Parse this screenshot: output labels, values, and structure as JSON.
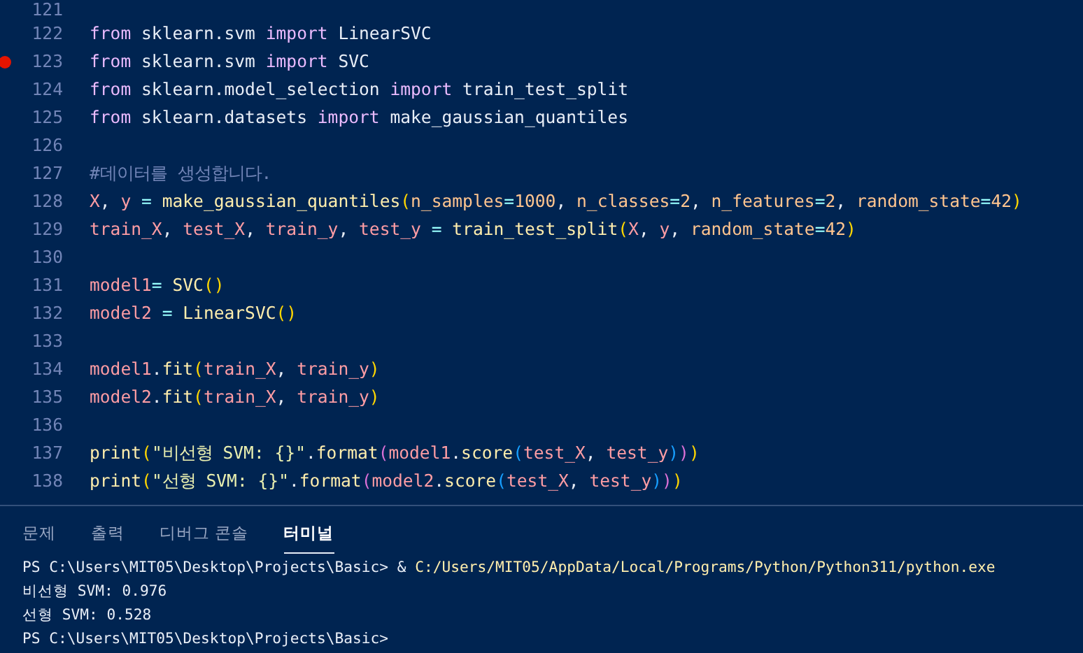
{
  "editor": {
    "lines": [
      {
        "number": "121",
        "breakpoint": false
      },
      {
        "number": "122",
        "breakpoint": false,
        "tokens": [
          {
            "text": "from",
            "kind": "k"
          },
          {
            "text": " sklearn.svm ",
            "kind": "m"
          },
          {
            "text": "import",
            "kind": "k"
          },
          {
            "text": " LinearSVC",
            "kind": "m"
          }
        ]
      },
      {
        "number": "123",
        "breakpoint": true,
        "tokens": [
          {
            "text": "from",
            "kind": "k"
          },
          {
            "text": " sklearn.svm ",
            "kind": "m"
          },
          {
            "text": "import",
            "kind": "k"
          },
          {
            "text": " SVC",
            "kind": "m"
          }
        ]
      },
      {
        "number": "124",
        "breakpoint": false,
        "tokens": [
          {
            "text": "from",
            "kind": "k"
          },
          {
            "text": " sklearn.model_selection ",
            "kind": "m"
          },
          {
            "text": "import",
            "kind": "k"
          },
          {
            "text": " train_test_split",
            "kind": "m"
          }
        ]
      },
      {
        "number": "125",
        "breakpoint": false,
        "tokens": [
          {
            "text": "from",
            "kind": "k"
          },
          {
            "text": " sklearn.datasets ",
            "kind": "m"
          },
          {
            "text": "import",
            "kind": "k"
          },
          {
            "text": " make_gaussian_quantiles",
            "kind": "m"
          }
        ]
      },
      {
        "number": "126",
        "breakpoint": false
      },
      {
        "number": "127",
        "breakpoint": false,
        "tokens": [
          {
            "text": "#데이터를 생성합니다.",
            "kind": "c"
          }
        ]
      },
      {
        "number": "128",
        "breakpoint": false,
        "tokens": [
          {
            "text": "X",
            "kind": "v"
          },
          {
            "text": ", ",
            "kind": "m"
          },
          {
            "text": "y",
            "kind": "v"
          },
          {
            "text": " = ",
            "kind": "o"
          },
          {
            "text": "make_gaussian_quantiles",
            "kind": "f"
          },
          {
            "text": "(",
            "kind": "p1"
          },
          {
            "text": "n_samples",
            "kind": "n"
          },
          {
            "text": "=",
            "kind": "o"
          },
          {
            "text": "1000",
            "kind": "n"
          },
          {
            "text": ", ",
            "kind": "m"
          },
          {
            "text": "n_classes",
            "kind": "n"
          },
          {
            "text": "=",
            "kind": "o"
          },
          {
            "text": "2",
            "kind": "n"
          },
          {
            "text": ", ",
            "kind": "m"
          },
          {
            "text": "n_features",
            "kind": "n"
          },
          {
            "text": "=",
            "kind": "o"
          },
          {
            "text": "2",
            "kind": "n"
          },
          {
            "text": ", ",
            "kind": "m"
          },
          {
            "text": "random_state",
            "kind": "n"
          },
          {
            "text": "=",
            "kind": "o"
          },
          {
            "text": "42",
            "kind": "n"
          },
          {
            "text": ")",
            "kind": "p1"
          }
        ]
      },
      {
        "number": "129",
        "breakpoint": false,
        "tokens": [
          {
            "text": "train_X",
            "kind": "v"
          },
          {
            "text": ", ",
            "kind": "m"
          },
          {
            "text": "test_X",
            "kind": "v"
          },
          {
            "text": ", ",
            "kind": "m"
          },
          {
            "text": "train_y",
            "kind": "v"
          },
          {
            "text": ", ",
            "kind": "m"
          },
          {
            "text": "test_y",
            "kind": "v"
          },
          {
            "text": " = ",
            "kind": "o"
          },
          {
            "text": "train_test_split",
            "kind": "f"
          },
          {
            "text": "(",
            "kind": "p1"
          },
          {
            "text": "X",
            "kind": "v"
          },
          {
            "text": ", ",
            "kind": "m"
          },
          {
            "text": "y",
            "kind": "v"
          },
          {
            "text": ", ",
            "kind": "m"
          },
          {
            "text": "random_state",
            "kind": "n"
          },
          {
            "text": "=",
            "kind": "o"
          },
          {
            "text": "42",
            "kind": "n"
          },
          {
            "text": ")",
            "kind": "p1"
          }
        ]
      },
      {
        "number": "130",
        "breakpoint": false
      },
      {
        "number": "131",
        "breakpoint": false,
        "tokens": [
          {
            "text": "model1",
            "kind": "v"
          },
          {
            "text": "= ",
            "kind": "o"
          },
          {
            "text": "SVC",
            "kind": "f"
          },
          {
            "text": "()",
            "kind": "p1"
          }
        ]
      },
      {
        "number": "132",
        "breakpoint": false,
        "tokens": [
          {
            "text": "model2",
            "kind": "v"
          },
          {
            "text": " = ",
            "kind": "o"
          },
          {
            "text": "LinearSVC",
            "kind": "f"
          },
          {
            "text": "()",
            "kind": "p1"
          }
        ]
      },
      {
        "number": "133",
        "breakpoint": false
      },
      {
        "number": "134",
        "breakpoint": false,
        "tokens": [
          {
            "text": "model1",
            "kind": "v"
          },
          {
            "text": ".",
            "kind": "m"
          },
          {
            "text": "fit",
            "kind": "f"
          },
          {
            "text": "(",
            "kind": "p1"
          },
          {
            "text": "train_X",
            "kind": "v"
          },
          {
            "text": ", ",
            "kind": "m"
          },
          {
            "text": "train_y",
            "kind": "v"
          },
          {
            "text": ")",
            "kind": "p1"
          }
        ]
      },
      {
        "number": "135",
        "breakpoint": false,
        "tokens": [
          {
            "text": "model2",
            "kind": "v"
          },
          {
            "text": ".",
            "kind": "m"
          },
          {
            "text": "fit",
            "kind": "f"
          },
          {
            "text": "(",
            "kind": "p1"
          },
          {
            "text": "train_X",
            "kind": "v"
          },
          {
            "text": ", ",
            "kind": "m"
          },
          {
            "text": "train_y",
            "kind": "v"
          },
          {
            "text": ")",
            "kind": "p1"
          }
        ]
      },
      {
        "number": "136",
        "breakpoint": false
      },
      {
        "number": "137",
        "breakpoint": false,
        "tokens": [
          {
            "text": "print",
            "kind": "f"
          },
          {
            "text": "(",
            "kind": "p1"
          },
          {
            "text": "\"비선형 SVM: {}\"",
            "kind": "s"
          },
          {
            "text": ".",
            "kind": "m"
          },
          {
            "text": "format",
            "kind": "f"
          },
          {
            "text": "(",
            "kind": "p2"
          },
          {
            "text": "model1",
            "kind": "v"
          },
          {
            "text": ".",
            "kind": "m"
          },
          {
            "text": "score",
            "kind": "f"
          },
          {
            "text": "(",
            "kind": "p3"
          },
          {
            "text": "test_X",
            "kind": "v"
          },
          {
            "text": ", ",
            "kind": "m"
          },
          {
            "text": "test_y",
            "kind": "v"
          },
          {
            "text": ")",
            "kind": "p3"
          },
          {
            "text": ")",
            "kind": "p2"
          },
          {
            "text": ")",
            "kind": "p1"
          }
        ]
      },
      {
        "number": "138",
        "breakpoint": false,
        "tokens": [
          {
            "text": "print",
            "kind": "f"
          },
          {
            "text": "(",
            "kind": "p1"
          },
          {
            "text": "\"선형 SVM: {}\"",
            "kind": "s"
          },
          {
            "text": ".",
            "kind": "m"
          },
          {
            "text": "format",
            "kind": "f"
          },
          {
            "text": "(",
            "kind": "p2"
          },
          {
            "text": "model2",
            "kind": "v"
          },
          {
            "text": ".",
            "kind": "m"
          },
          {
            "text": "score",
            "kind": "f"
          },
          {
            "text": "(",
            "kind": "p3"
          },
          {
            "text": "test_X",
            "kind": "v"
          },
          {
            "text": ", ",
            "kind": "m"
          },
          {
            "text": "test_y",
            "kind": "v"
          },
          {
            "text": ")",
            "kind": "p3"
          },
          {
            "text": ")",
            "kind": "p2"
          },
          {
            "text": ")",
            "kind": "p1"
          }
        ]
      }
    ]
  },
  "panel": {
    "tabs": [
      {
        "label": "문제",
        "selected": false
      },
      {
        "label": "출력",
        "selected": false
      },
      {
        "label": "디버그 콘솔",
        "selected": false
      },
      {
        "label": "터미널",
        "selected": true
      }
    ],
    "terminal_lines": [
      [
        {
          "text": "PS C:\\Users\\MIT05\\Desktop\\Projects\\Basic> & ",
          "kind": "m"
        },
        {
          "text": "C:/Users/MIT05/AppData/Local/Programs/Python/Python311/python.exe",
          "kind": "f"
        }
      ],
      [
        {
          "text": "비선형 SVM: 0.976",
          "kind": "m"
        }
      ],
      [
        {
          "text": "선형 SVM: 0.528",
          "kind": "m"
        }
      ],
      [
        {
          "text": "PS C:\\Users\\MIT05\\Desktop\\Projects\\Basic>",
          "kind": "m"
        }
      ]
    ]
  }
}
